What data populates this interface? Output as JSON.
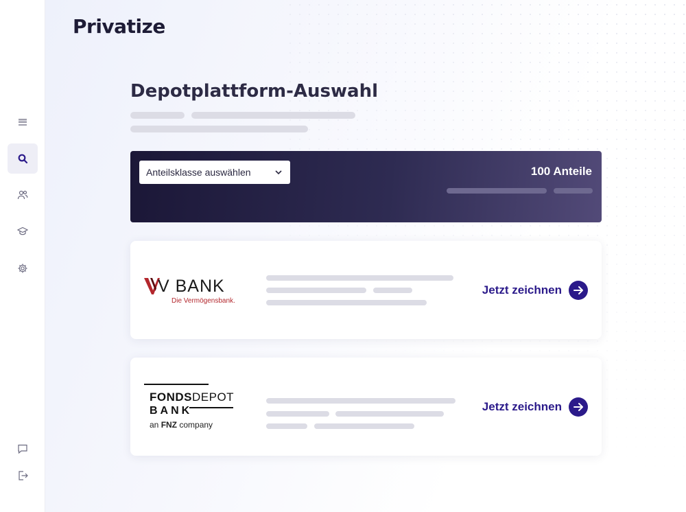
{
  "app": {
    "logo": "Privatize"
  },
  "sidebar": {
    "items": [
      {
        "icon": "menu-icon"
      },
      {
        "icon": "search-icon",
        "active": true
      },
      {
        "icon": "users-icon"
      },
      {
        "icon": "graduation-cap-icon"
      },
      {
        "icon": "gear-icon"
      },
      {
        "icon": "chat-icon"
      },
      {
        "icon": "logout-icon"
      }
    ]
  },
  "page": {
    "title": "Depotplattform-Auswahl"
  },
  "banner": {
    "select": {
      "value": "Anteilsklasse auswählen"
    },
    "shares_label": "100 Anteile"
  },
  "cards": [
    {
      "bank": "V BANK",
      "logo_wordmark": "V BANK",
      "logo_tagline": "Die Vermögensbank.",
      "cta_label": "Jetzt zeichnen"
    },
    {
      "bank": "FONDSDEPOT BANK",
      "logo_line1_bold": "FONDS",
      "logo_line1_rest": "DEPOT",
      "logo_line2": "BANK",
      "logo_line3_prefix": "an ",
      "logo_line3_bold": "FNZ",
      "logo_line3_suffix": " company",
      "cta_label": "Jetzt zeichnen"
    }
  ],
  "colors": {
    "accent": "#2b1a8a",
    "banner_start": "#1b1737",
    "banner_end": "#524a78",
    "vbank_red": "#b3272d"
  }
}
